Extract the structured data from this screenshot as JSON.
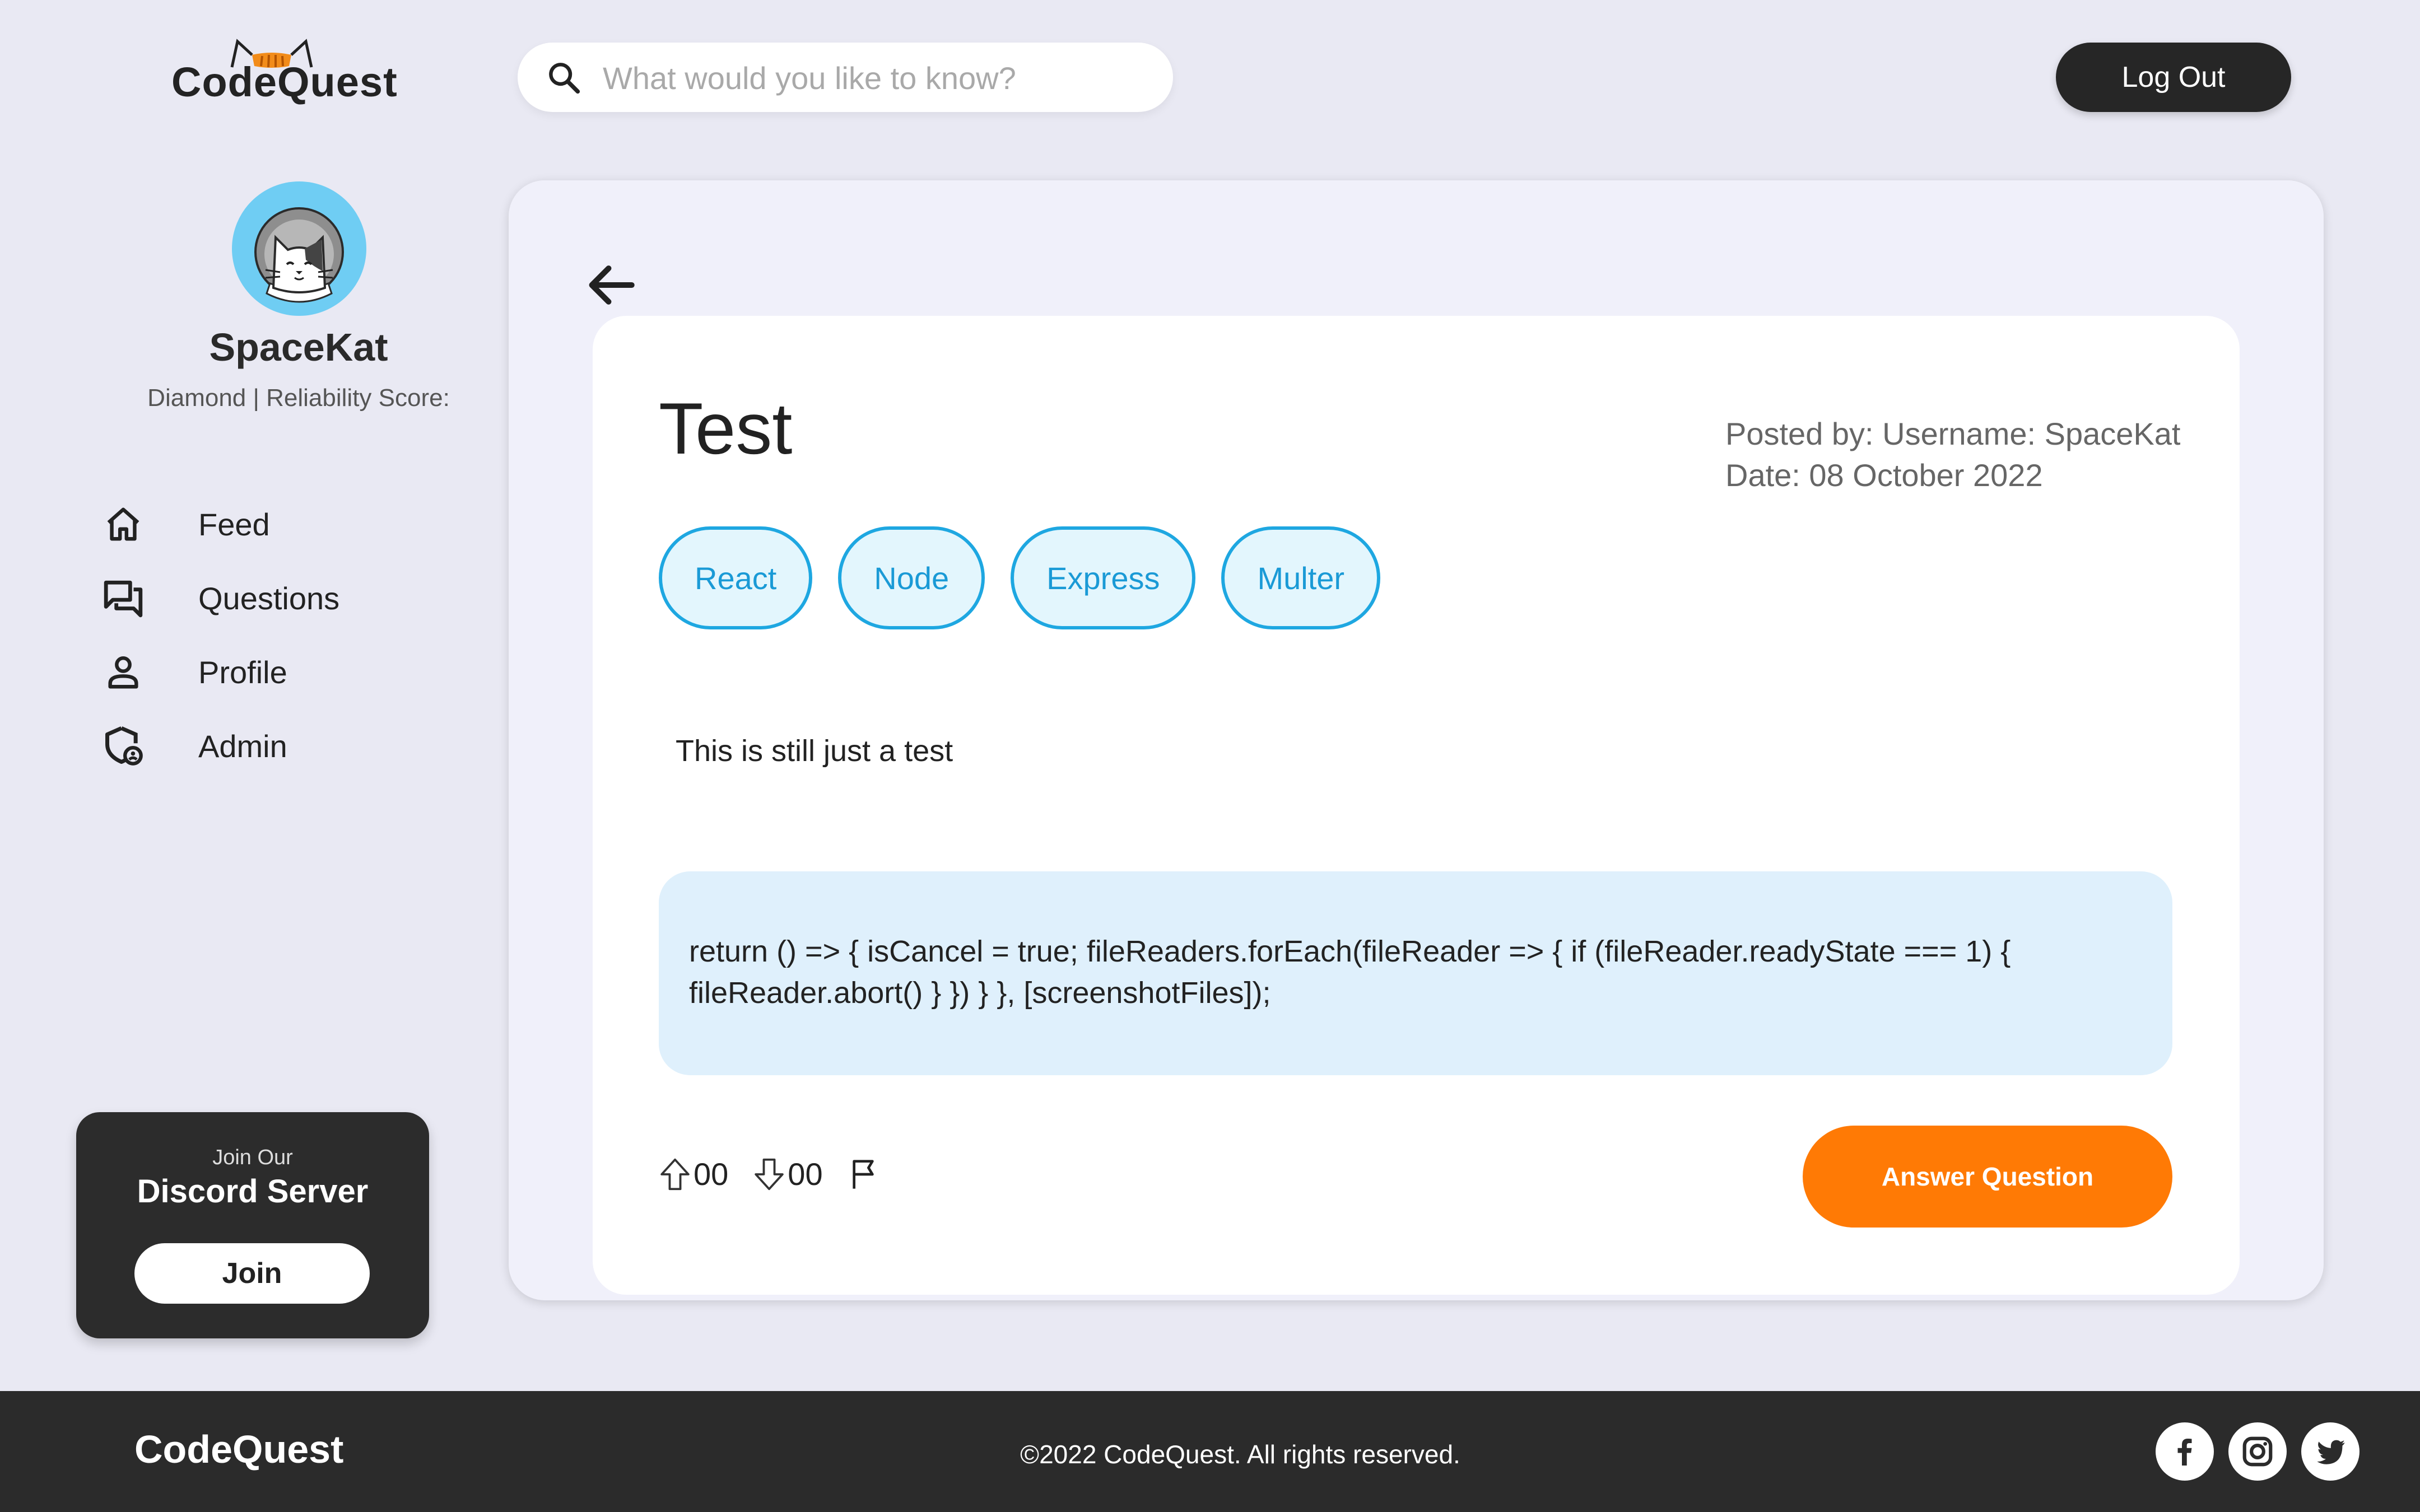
{
  "header": {
    "brand": "CodeQuest",
    "search_placeholder": "What would you like to know?",
    "logout_label": "Log Out"
  },
  "sidebar": {
    "username": "SpaceKat",
    "rank_line": "Diamond | Reliability Score:",
    "nav": [
      {
        "label": "Feed",
        "icon": "home-icon"
      },
      {
        "label": "Questions",
        "icon": "questions-icon"
      },
      {
        "label": "Profile",
        "icon": "profile-icon"
      },
      {
        "label": "Admin",
        "icon": "admin-shield-icon"
      }
    ],
    "discord": {
      "small": "Join Our",
      "big": "Discord Server",
      "button": "Join"
    }
  },
  "question": {
    "title": "Test",
    "posted_by": "Posted by: Username: SpaceKat",
    "date": "Date: 08 October 2022",
    "tags": [
      "React",
      "Node",
      "Express",
      "Multer"
    ],
    "body": "This is still just a test",
    "code_line1": "return () => { isCancel = true; fileReaders.forEach(fileReader => { if (fileReader.readyState === 1) {",
    "code_line2": "fileReader.abort() } }) } }, [screenshotFiles]);",
    "upvotes": "00",
    "downvotes": "00",
    "answer_label": "Answer Question"
  },
  "footer": {
    "brand": "CodeQuest",
    "copyright": "©2022 CodeQuest. All rights reserved."
  },
  "colors": {
    "accent_orange": "#ff7a05",
    "tag_blue": "#1ea7e1",
    "dark": "#2b2b2b",
    "background": "#e9e9f3"
  }
}
